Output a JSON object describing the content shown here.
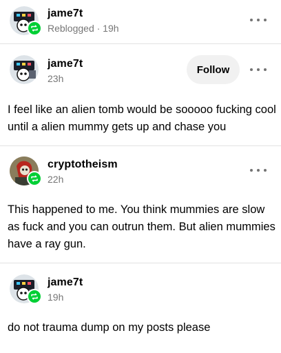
{
  "header_post": {
    "username": "jame7t",
    "meta": "Reblogged · 19h"
  },
  "posts": [
    {
      "username": "jame7t",
      "meta": "23h",
      "follow_label": "Follow",
      "text": "I feel like an alien tomb would be sooooo fucking cool until a alien mummy gets up and chase you"
    },
    {
      "username": "cryptotheism",
      "meta": "22h",
      "text": "This happened to me. You think mummies are slow as fuck and you can outrun them. But alien mummies have a ray gun."
    },
    {
      "username": "jame7t",
      "meta": "19h",
      "text": "do not trauma dump on my posts please"
    }
  ],
  "colors": {
    "reblog_green": "#00cf35",
    "follow_bg": "#f1f1f1",
    "divider": "#e2e2e2"
  },
  "icons": {
    "reblog": "reblog-icon",
    "more": "more-options-icon",
    "avatar_jame7t": "robot-avatar",
    "avatar_cryptotheism": "skull-avatar"
  }
}
